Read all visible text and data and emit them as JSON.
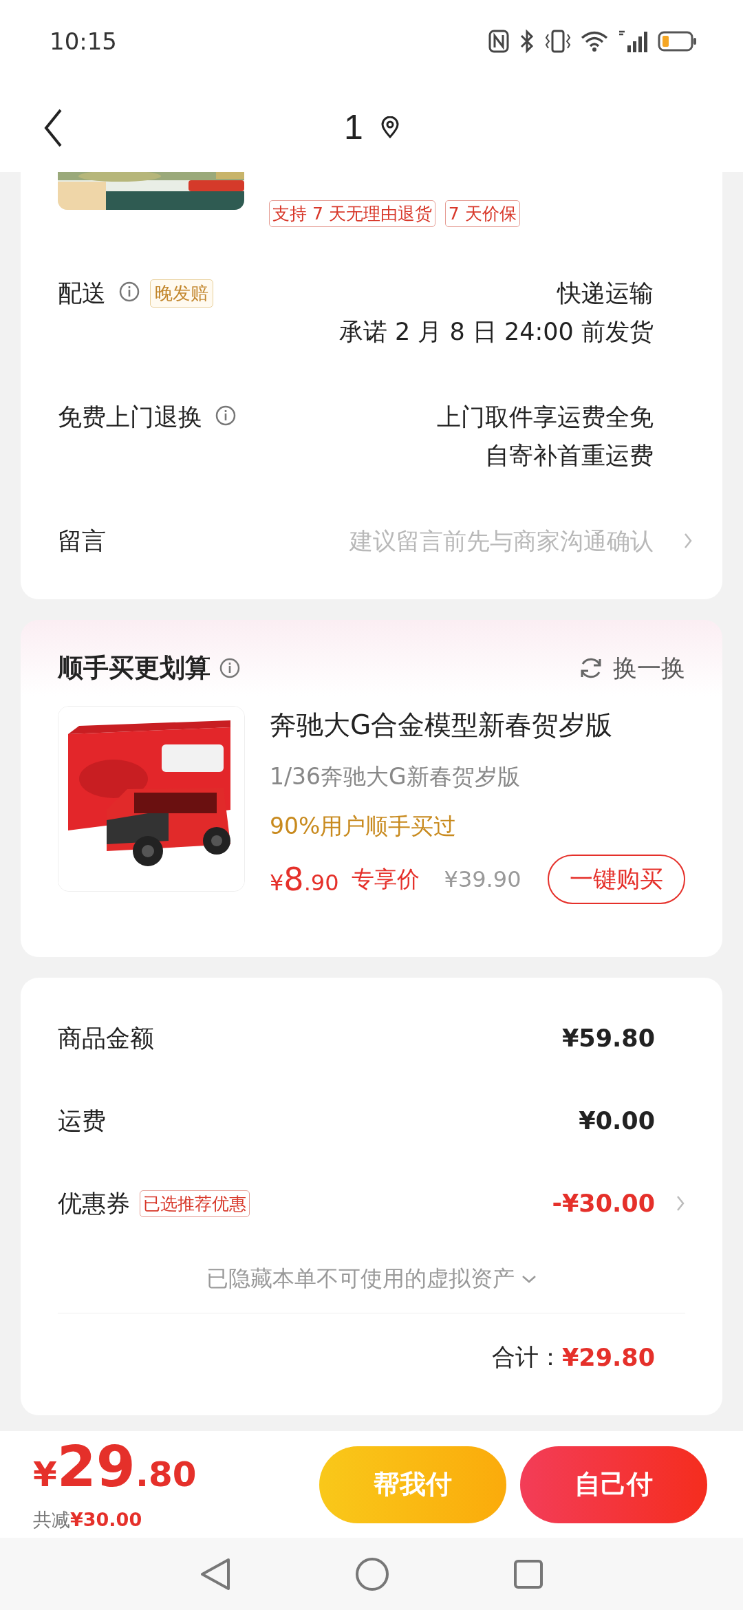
{
  "status_bar": {
    "time": "10:15"
  },
  "nav": {
    "title": "1"
  },
  "product_card": {
    "tags": [
      "支持 7 天无理由退货",
      "7 天价保"
    ]
  },
  "details": [
    {
      "label": "配送",
      "info": true,
      "badge": "晚发赔",
      "lines": [
        "快递运输",
        "承诺 2 月 8 日 24:00 前发货"
      ]
    },
    {
      "label": "免费上门退换",
      "info": true,
      "lines": [
        "上门取件享运费全免",
        "自寄补首重运费"
      ]
    },
    {
      "label": "留言",
      "hint": "建议留言前先与商家沟通确认",
      "chevron": true
    }
  ],
  "upsell": {
    "title": "顺手买更划算",
    "info": true,
    "refresh": "换一换",
    "product": {
      "name": "奔驰大G合金模型新春贺岁版",
      "spec": "1/36奔驰大G新春贺岁版",
      "social": "90%用户顺手买过",
      "currency": "¥",
      "price_int": "8",
      "price_dec": ".90",
      "price_label": "专享价",
      "original_price": "¥39.90",
      "button": "一键购买"
    }
  },
  "summary": {
    "rows": [
      {
        "kind": "plain",
        "label": "商品金额",
        "value": "¥59.80"
      },
      {
        "kind": "plain",
        "label": "运费",
        "value": "¥0.00"
      },
      {
        "kind": "discount",
        "label": "优惠券",
        "badge": "已选推荐优惠",
        "value": "-¥30.00"
      }
    ],
    "hidden_note": "已隐藏本单不可使用的虚拟资产",
    "total_label": "合计：",
    "total": "¥29.80"
  },
  "bottom_bar": {
    "currency": "¥",
    "price_int": "29",
    "price_dec": ".80",
    "saved_label": "共减",
    "saved": "¥30.00",
    "buttons": [
      {
        "kind": "secondary",
        "label": "帮我付"
      },
      {
        "kind": "primary",
        "label": "自己付"
      }
    ]
  }
}
